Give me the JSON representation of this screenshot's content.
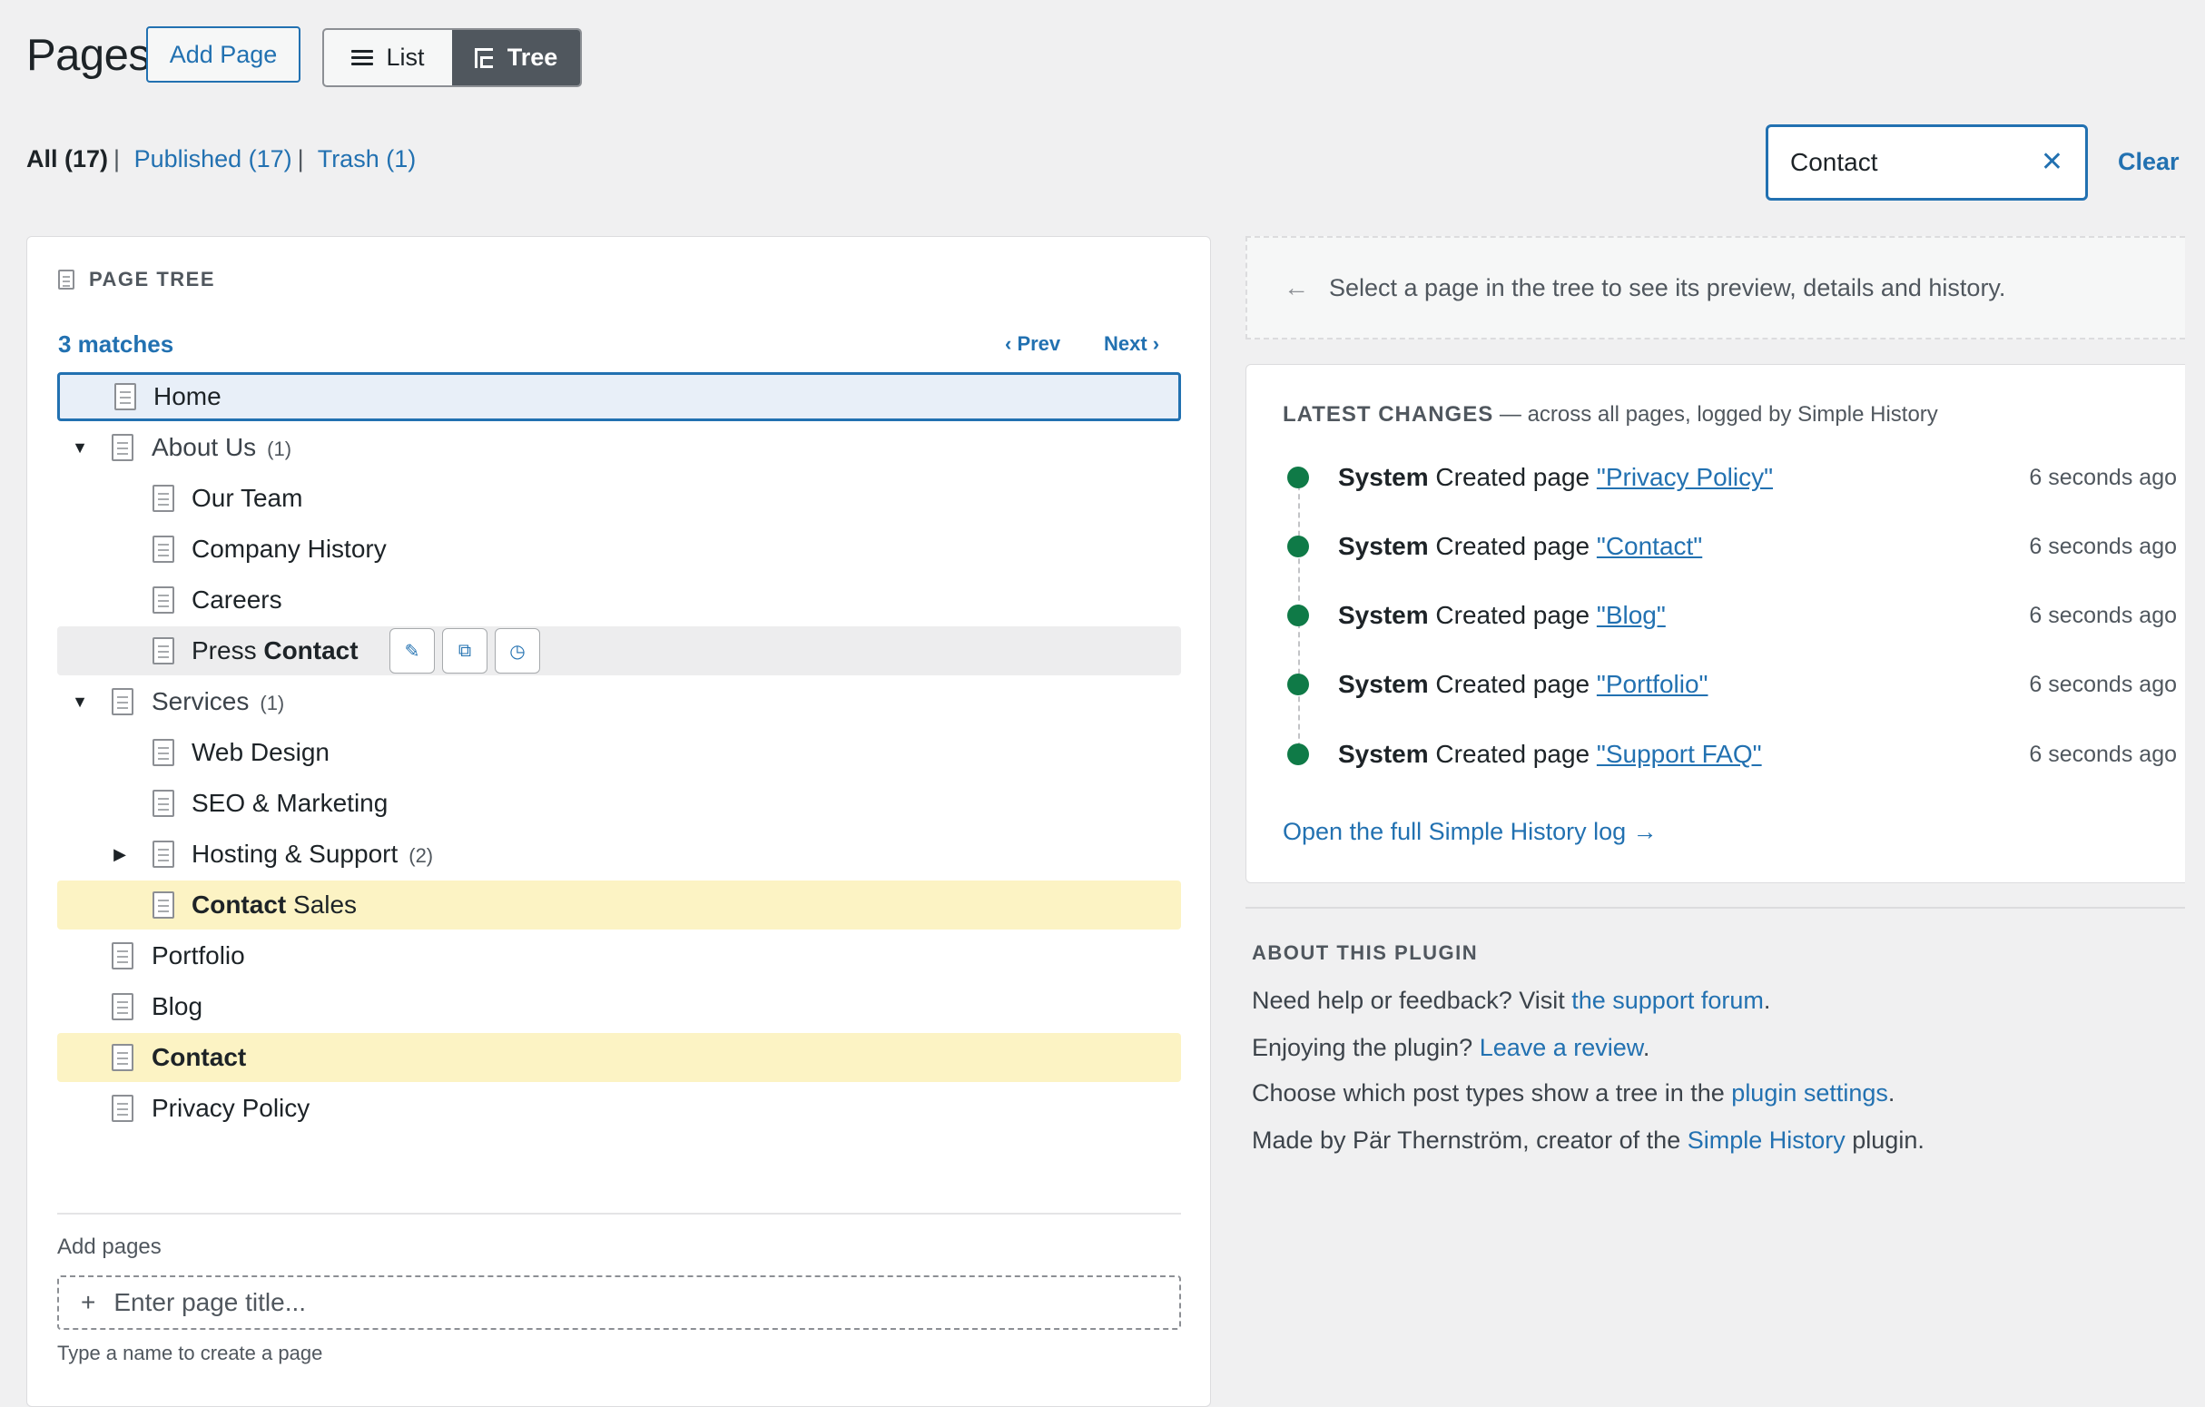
{
  "header": {
    "title": "Pages",
    "add_page": "Add Page",
    "views": [
      {
        "label": "List",
        "icon": "list-icon",
        "active": false
      },
      {
        "label": "Tree",
        "icon": "tree-icon",
        "active": true
      }
    ]
  },
  "filters": {
    "all": "All (17)",
    "sep": "|",
    "published": "Published (17)",
    "trash": "Trash (1)"
  },
  "search": {
    "value": "Contact",
    "clear_symbol": "✕",
    "clear_label": "Clear"
  },
  "tree": {
    "heading": "PAGE TREE",
    "matches": "3 matches",
    "prev": "‹ Prev",
    "next": "Next ›",
    "rows": [
      {
        "label": "Home",
        "state": "selected"
      },
      {
        "toggle": "▼",
        "label": "About Us",
        "count": "(1)"
      },
      {
        "label": "Our Team"
      },
      {
        "label": "Company History"
      },
      {
        "label": "Careers"
      },
      {
        "label_pre": "Press ",
        "label_match": "Contact",
        "state": "hover"
      },
      {
        "toggle": "▼",
        "label": "Services",
        "count": "(1)"
      },
      {
        "label": "Web Design"
      },
      {
        "label": "SEO & Marketing"
      },
      {
        "toggle": "▶",
        "label": "Hosting & Support",
        "count": "(2)"
      },
      {
        "label_match": "Contact",
        "label_post": " Sales",
        "state": "match"
      },
      {
        "label": "Portfolio"
      },
      {
        "label": "Blog"
      },
      {
        "label_match": "Contact",
        "state": "match"
      },
      {
        "label": "Privacy Policy"
      }
    ],
    "row_actions": [
      "edit-icon",
      "view-external-icon",
      "history-icon"
    ],
    "add_label": "Add pages",
    "add_plus": "+",
    "add_placeholder": "Enter page title...",
    "add_hint": "Type a name to create a page"
  },
  "preview_hint": {
    "arrow": "←",
    "text": "Select a page in the tree to see its preview, details and history."
  },
  "latest_changes": {
    "title": "LATEST CHANGES",
    "subtitle": " — across all pages, logged by Simple History",
    "events": [
      {
        "user": "System",
        "action": " Created page ",
        "page": "\"Privacy Policy\"",
        "time": "6 seconds ago"
      },
      {
        "user": "System",
        "action": " Created page ",
        "page": "\"Contact\"",
        "time": "6 seconds ago"
      },
      {
        "user": "System",
        "action": " Created page ",
        "page": "\"Blog\"",
        "time": "6 seconds ago"
      },
      {
        "user": "System",
        "action": " Created page ",
        "page": "\"Portfolio\"",
        "time": "6 seconds ago"
      },
      {
        "user": "System",
        "action": " Created page ",
        "page": "\"Support FAQ\"",
        "time": "6 seconds ago"
      }
    ],
    "open_log": "Open the full Simple History log →",
    "dot_color": "#0f7a47"
  },
  "about": {
    "title": "ABOUT THIS PLUGIN",
    "l1_pre": "Need help or feedback? Visit ",
    "l1_link": "the support forum",
    "l1_post": ".",
    "l2_pre": "Enjoying the plugin? ",
    "l2_link": "Leave a review",
    "l2_post": ".",
    "l3_pre": "Choose which post types show a tree in the ",
    "l3_link": "plugin settings",
    "l3_post": ".",
    "l4_pre": "Made by Pär Thernström, creator of the ",
    "l4_link": "Simple History",
    "l4_post": " plugin."
  },
  "colors": {
    "accent": "#2271b1",
    "match_highlight": "#fcf3c4",
    "selected_bg": "#e8eff8",
    "toggle_active_bg": "#50575e"
  }
}
